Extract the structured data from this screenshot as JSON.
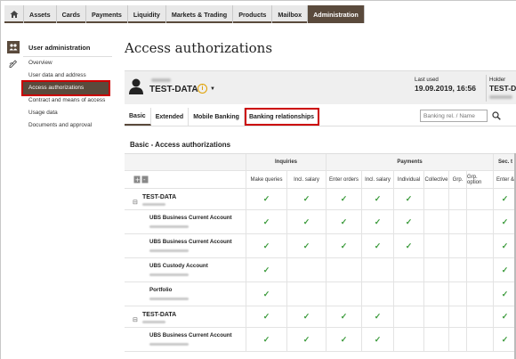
{
  "topnav": {
    "items": [
      "Assets",
      "Cards",
      "Payments",
      "Liquidity",
      "Markets & Trading",
      "Products",
      "Mailbox",
      "Administration"
    ],
    "active": "Administration"
  },
  "sidebar": {
    "title": "User administration",
    "items": [
      "Overview",
      "User data and address",
      "Access authorizations",
      "Contract and means of access",
      "Usage data",
      "Documents and approval"
    ],
    "active": "Access authorizations"
  },
  "page_title": "Access authorizations",
  "userbar": {
    "username": "TEST-DATA",
    "last_used_label": "Last used",
    "last_used": "19.09.2019, 16:56",
    "holder_label": "Holder",
    "holder": "TEST-D"
  },
  "tabs": [
    "Basic",
    "Extended",
    "Mobile Banking",
    "Banking relationships"
  ],
  "search": {
    "placeholder": "Banking rel. / Name"
  },
  "section_title": "Basic - Access authorizations",
  "table": {
    "groups": [
      {
        "label": "Inquiries"
      },
      {
        "label": "Payments"
      },
      {
        "label": "Sec. t"
      }
    ],
    "columns": [
      "Make queries",
      "Incl. salary",
      "Enter orders",
      "Incl. salary",
      "Individual",
      "Collective",
      "Grp.",
      "Grp. option",
      "Enter &"
    ],
    "rows": [
      {
        "type": "group",
        "name": "TEST-DATA",
        "checks": [
          true,
          true,
          true,
          true,
          true,
          false,
          false,
          false,
          true
        ]
      },
      {
        "type": "account",
        "name": "UBS Business Current Account",
        "checks": [
          true,
          true,
          true,
          true,
          true,
          false,
          false,
          false,
          true
        ]
      },
      {
        "type": "account",
        "name": "UBS Business Current Account",
        "checks": [
          true,
          true,
          true,
          true,
          true,
          false,
          false,
          false,
          true
        ]
      },
      {
        "type": "account",
        "name": "UBS Custody Account",
        "checks": [
          true,
          false,
          false,
          false,
          false,
          false,
          false,
          false,
          true
        ]
      },
      {
        "type": "account",
        "name": "Portfolio",
        "checks": [
          true,
          false,
          false,
          false,
          false,
          false,
          false,
          false,
          true
        ]
      },
      {
        "type": "group",
        "name": "TEST-DATA",
        "checks": [
          true,
          true,
          true,
          true,
          false,
          false,
          false,
          false,
          true
        ]
      },
      {
        "type": "account",
        "name": "UBS Business Current Account",
        "checks": [
          true,
          true,
          true,
          true,
          false,
          false,
          false,
          false,
          true
        ]
      }
    ]
  },
  "colors": {
    "brand": "#5a4a3c",
    "highlight": "#cc0000",
    "check": "#3a9a3a"
  }
}
